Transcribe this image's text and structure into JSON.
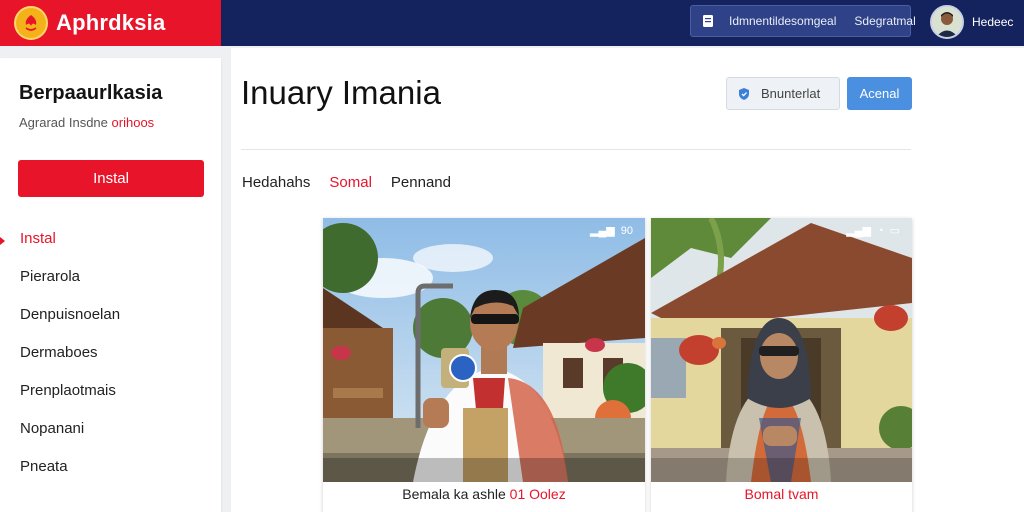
{
  "header": {
    "app_name": "Aphrdksia",
    "action_1": "Idmnentildesomgeal",
    "action_2": "Sdegratmal",
    "user_name": "Hedeec"
  },
  "sidebar": {
    "title": "Berpaaurlkasia",
    "subtitle_main": "Agrarad Insdne",
    "subtitle_accent": "orihoos",
    "install_button": "Instal",
    "items": [
      {
        "label": "Instal",
        "active": true
      },
      {
        "label": "Pierarola"
      },
      {
        "label": "Denpuisnoelan"
      },
      {
        "label": "Dermaboes"
      },
      {
        "label": "Prenplaotmais"
      },
      {
        "label": "Nopanani"
      },
      {
        "label": "Pneata"
      }
    ]
  },
  "main": {
    "title": "Inuary Imania",
    "secondary_button": "Bnunterlat",
    "primary_button": "Acenal",
    "tabs": [
      {
        "label": "Hedahahs"
      },
      {
        "label": "Somal",
        "active": true
      },
      {
        "label": "Pennand"
      }
    ]
  },
  "cards": [
    {
      "caption_main": "Bemala ka ashle",
      "caption_accent": "01 Oolez",
      "status_text": "90"
    },
    {
      "caption_main": "Bomal tvam",
      "status_text": ""
    }
  ],
  "colors": {
    "brand_red": "#e8142a",
    "navy": "#14235e",
    "primary_blue": "#4a8fe0"
  }
}
